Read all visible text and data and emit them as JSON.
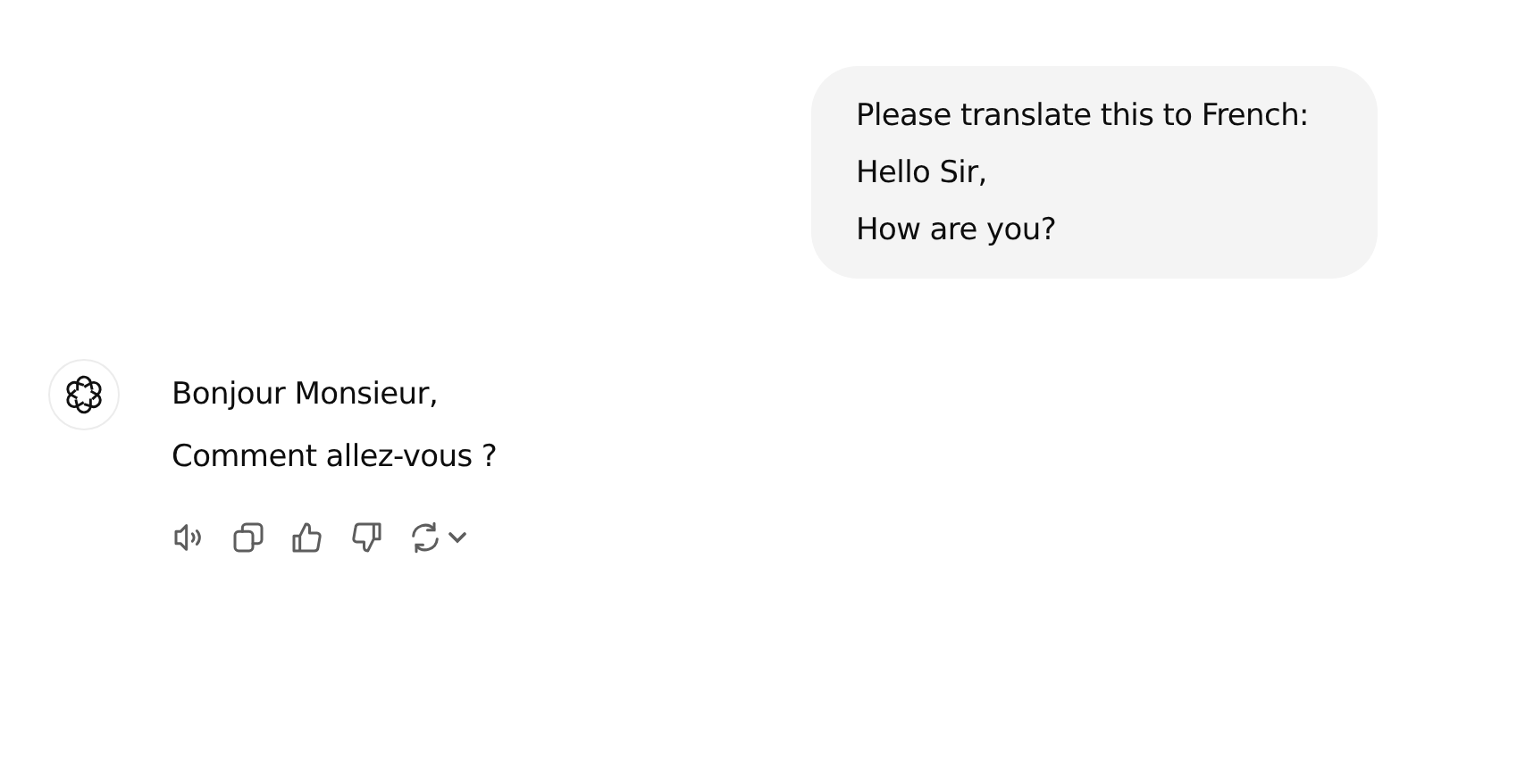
{
  "user_message": {
    "lines": [
      "Please translate this to French:",
      "Hello Sir,",
      "How are you?"
    ]
  },
  "assistant_message": {
    "lines": [
      "Bonjour Monsieur,",
      "Comment allez-vous ?"
    ],
    "actions": [
      {
        "kind": "speaker"
      },
      {
        "kind": "copy"
      },
      {
        "kind": "thumbs-up"
      },
      {
        "kind": "thumbs-down"
      },
      {
        "kind": "regenerate"
      }
    ]
  }
}
